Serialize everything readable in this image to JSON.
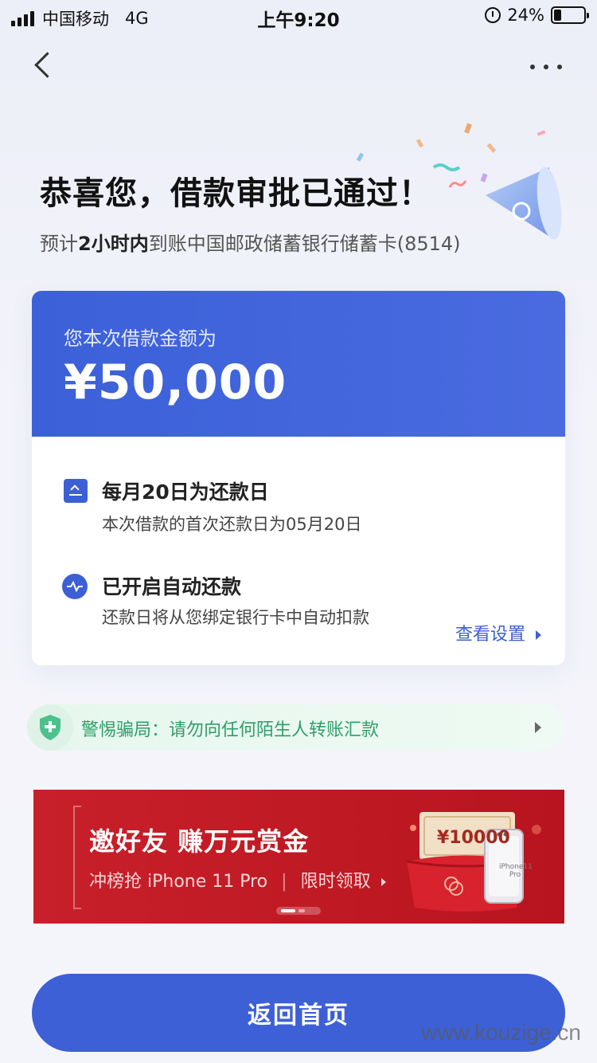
{
  "status_bar": {
    "carrier": "中国移动",
    "network": "4G",
    "time": "上午9:20",
    "battery": "24%",
    "battery_level": 0.24
  },
  "header": {
    "back_icon": "chevron-left-icon",
    "more_icon": "more-dots-icon"
  },
  "success": {
    "title": "恭喜您，借款审批已通过！",
    "sub_prefix": "预计",
    "sub_bold": "2小时内",
    "sub_suffix": "到账中国邮政储蓄银行储蓄卡(8514)"
  },
  "loan": {
    "amount_label": "您本次借款金额为",
    "amount_value": "¥50,000",
    "repay_title": "每月20日为还款日",
    "repay_desc": "本次借款的首次还款日为05月20日",
    "auto_title": "已开启自动还款",
    "auto_desc": "还款日将从您绑定银行卡中自动扣款",
    "settings_link": "查看设置"
  },
  "warning": {
    "text": "警惕骗局：请勿向任何陌生人转账汇款"
  },
  "promo": {
    "title": "邀好友 赚万元赏金",
    "subtitle_left": "冲榜抢 iPhone 11 Pro",
    "subtitle_right": "限时领取",
    "voucher_text": "¥10000",
    "phone_text": "iPhone11 Pro"
  },
  "footer": {
    "home_button": "返回首页",
    "watermark": "www.kouzige.cn"
  },
  "colors": {
    "primary": "#3d60d6",
    "warning_green": "#2f9e6a",
    "promo_red": "#c8202a"
  }
}
